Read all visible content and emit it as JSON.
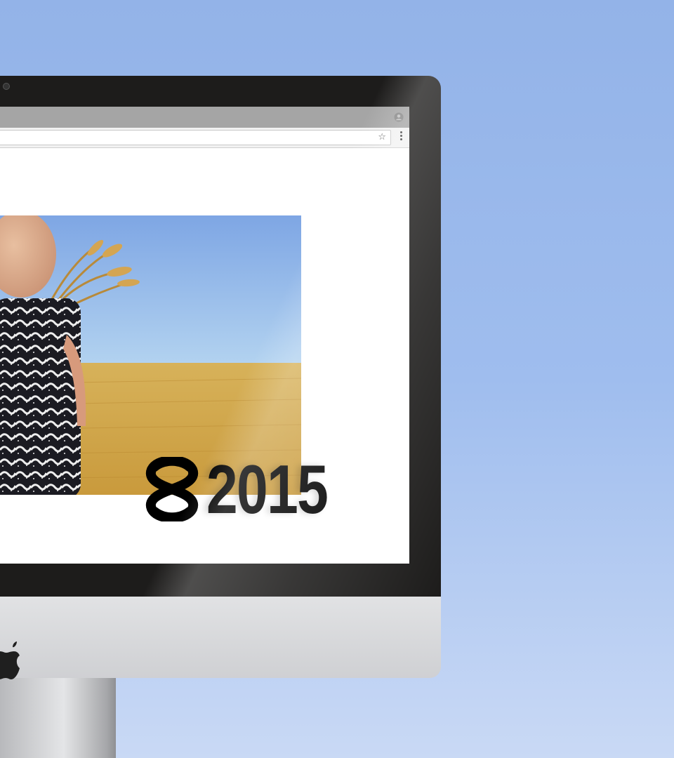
{
  "website": {
    "brand": {
      "year": "2015",
      "symbol_icon": "double-s-logo-icon"
    },
    "hero_image": {
      "icon": "woman-wheat-field-photo"
    }
  },
  "browser": {
    "toolbar_icons": [
      "star-icon",
      "menu-dots-icon"
    ],
    "titlebar_icons": [
      "profile-icon"
    ]
  },
  "device": {
    "logo_icon": "apple-logo-icon"
  },
  "colors": {
    "background_top": "#93b3e8",
    "background_bottom": "#c9d9f5",
    "bezel": "#1d1c1b",
    "chin": "#d8d9dc",
    "brand_text": "#000000"
  }
}
